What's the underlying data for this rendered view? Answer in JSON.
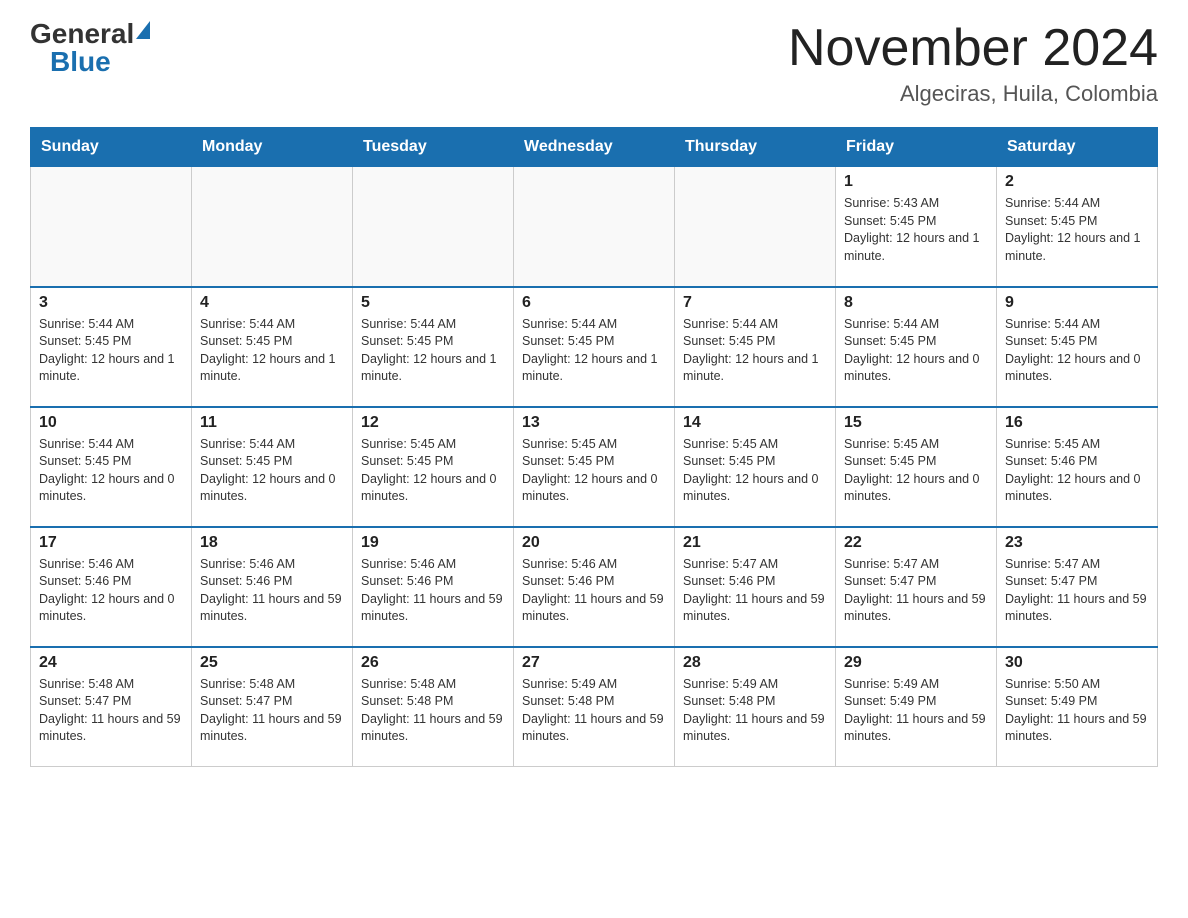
{
  "header": {
    "logo_general": "General",
    "logo_blue": "Blue",
    "month_title": "November 2024",
    "location": "Algeciras, Huila, Colombia"
  },
  "weekdays": [
    "Sunday",
    "Monday",
    "Tuesday",
    "Wednesday",
    "Thursday",
    "Friday",
    "Saturday"
  ],
  "weeks": [
    [
      {
        "day": "",
        "info": ""
      },
      {
        "day": "",
        "info": ""
      },
      {
        "day": "",
        "info": ""
      },
      {
        "day": "",
        "info": ""
      },
      {
        "day": "",
        "info": ""
      },
      {
        "day": "1",
        "info": "Sunrise: 5:43 AM\nSunset: 5:45 PM\nDaylight: 12 hours and 1 minute."
      },
      {
        "day": "2",
        "info": "Sunrise: 5:44 AM\nSunset: 5:45 PM\nDaylight: 12 hours and 1 minute."
      }
    ],
    [
      {
        "day": "3",
        "info": "Sunrise: 5:44 AM\nSunset: 5:45 PM\nDaylight: 12 hours and 1 minute."
      },
      {
        "day": "4",
        "info": "Sunrise: 5:44 AM\nSunset: 5:45 PM\nDaylight: 12 hours and 1 minute."
      },
      {
        "day": "5",
        "info": "Sunrise: 5:44 AM\nSunset: 5:45 PM\nDaylight: 12 hours and 1 minute."
      },
      {
        "day": "6",
        "info": "Sunrise: 5:44 AM\nSunset: 5:45 PM\nDaylight: 12 hours and 1 minute."
      },
      {
        "day": "7",
        "info": "Sunrise: 5:44 AM\nSunset: 5:45 PM\nDaylight: 12 hours and 1 minute."
      },
      {
        "day": "8",
        "info": "Sunrise: 5:44 AM\nSunset: 5:45 PM\nDaylight: 12 hours and 0 minutes."
      },
      {
        "day": "9",
        "info": "Sunrise: 5:44 AM\nSunset: 5:45 PM\nDaylight: 12 hours and 0 minutes."
      }
    ],
    [
      {
        "day": "10",
        "info": "Sunrise: 5:44 AM\nSunset: 5:45 PM\nDaylight: 12 hours and 0 minutes."
      },
      {
        "day": "11",
        "info": "Sunrise: 5:44 AM\nSunset: 5:45 PM\nDaylight: 12 hours and 0 minutes."
      },
      {
        "day": "12",
        "info": "Sunrise: 5:45 AM\nSunset: 5:45 PM\nDaylight: 12 hours and 0 minutes."
      },
      {
        "day": "13",
        "info": "Sunrise: 5:45 AM\nSunset: 5:45 PM\nDaylight: 12 hours and 0 minutes."
      },
      {
        "day": "14",
        "info": "Sunrise: 5:45 AM\nSunset: 5:45 PM\nDaylight: 12 hours and 0 minutes."
      },
      {
        "day": "15",
        "info": "Sunrise: 5:45 AM\nSunset: 5:45 PM\nDaylight: 12 hours and 0 minutes."
      },
      {
        "day": "16",
        "info": "Sunrise: 5:45 AM\nSunset: 5:46 PM\nDaylight: 12 hours and 0 minutes."
      }
    ],
    [
      {
        "day": "17",
        "info": "Sunrise: 5:46 AM\nSunset: 5:46 PM\nDaylight: 12 hours and 0 minutes."
      },
      {
        "day": "18",
        "info": "Sunrise: 5:46 AM\nSunset: 5:46 PM\nDaylight: 11 hours and 59 minutes."
      },
      {
        "day": "19",
        "info": "Sunrise: 5:46 AM\nSunset: 5:46 PM\nDaylight: 11 hours and 59 minutes."
      },
      {
        "day": "20",
        "info": "Sunrise: 5:46 AM\nSunset: 5:46 PM\nDaylight: 11 hours and 59 minutes."
      },
      {
        "day": "21",
        "info": "Sunrise: 5:47 AM\nSunset: 5:46 PM\nDaylight: 11 hours and 59 minutes."
      },
      {
        "day": "22",
        "info": "Sunrise: 5:47 AM\nSunset: 5:47 PM\nDaylight: 11 hours and 59 minutes."
      },
      {
        "day": "23",
        "info": "Sunrise: 5:47 AM\nSunset: 5:47 PM\nDaylight: 11 hours and 59 minutes."
      }
    ],
    [
      {
        "day": "24",
        "info": "Sunrise: 5:48 AM\nSunset: 5:47 PM\nDaylight: 11 hours and 59 minutes."
      },
      {
        "day": "25",
        "info": "Sunrise: 5:48 AM\nSunset: 5:47 PM\nDaylight: 11 hours and 59 minutes."
      },
      {
        "day": "26",
        "info": "Sunrise: 5:48 AM\nSunset: 5:48 PM\nDaylight: 11 hours and 59 minutes."
      },
      {
        "day": "27",
        "info": "Sunrise: 5:49 AM\nSunset: 5:48 PM\nDaylight: 11 hours and 59 minutes."
      },
      {
        "day": "28",
        "info": "Sunrise: 5:49 AM\nSunset: 5:48 PM\nDaylight: 11 hours and 59 minutes."
      },
      {
        "day": "29",
        "info": "Sunrise: 5:49 AM\nSunset: 5:49 PM\nDaylight: 11 hours and 59 minutes."
      },
      {
        "day": "30",
        "info": "Sunrise: 5:50 AM\nSunset: 5:49 PM\nDaylight: 11 hours and 59 minutes."
      }
    ]
  ]
}
